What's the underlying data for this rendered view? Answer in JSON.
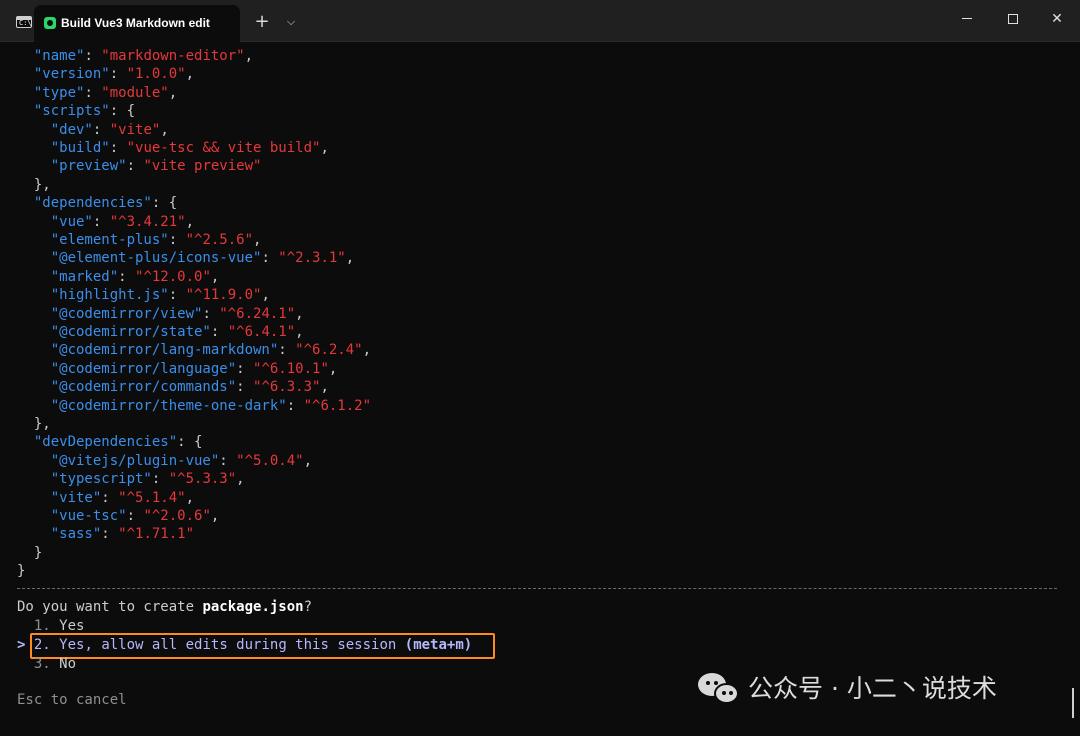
{
  "window": {
    "tab_title": "Build Vue3 Markdown edit",
    "new_tab": "+",
    "dropdown": "⌵",
    "minimize": "",
    "maximize": "",
    "close": "✕",
    "terminal_icon_label": "C:\\"
  },
  "json_lines": [
    [
      [
        "  ",
        "p"
      ],
      [
        "\"name\"",
        "k"
      ],
      [
        ": ",
        "p"
      ],
      [
        "\"markdown-editor\"",
        "s"
      ],
      [
        ",",
        "p"
      ]
    ],
    [
      [
        "  ",
        "p"
      ],
      [
        "\"version\"",
        "k"
      ],
      [
        ": ",
        "p"
      ],
      [
        "\"1.0.0\"",
        "s"
      ],
      [
        ",",
        "p"
      ]
    ],
    [
      [
        "  ",
        "p"
      ],
      [
        "\"type\"",
        "k"
      ],
      [
        ": ",
        "p"
      ],
      [
        "\"module\"",
        "s"
      ],
      [
        ",",
        "p"
      ]
    ],
    [
      [
        "  ",
        "p"
      ],
      [
        "\"scripts\"",
        "k"
      ],
      [
        ": {",
        "p"
      ]
    ],
    [
      [
        "    ",
        "p"
      ],
      [
        "\"dev\"",
        "k"
      ],
      [
        ": ",
        "p"
      ],
      [
        "\"vite\"",
        "s"
      ],
      [
        ",",
        "p"
      ]
    ],
    [
      [
        "    ",
        "p"
      ],
      [
        "\"build\"",
        "k"
      ],
      [
        ": ",
        "p"
      ],
      [
        "\"vue-tsc && vite build\"",
        "s"
      ],
      [
        ",",
        "p"
      ]
    ],
    [
      [
        "    ",
        "p"
      ],
      [
        "\"preview\"",
        "k"
      ],
      [
        ": ",
        "p"
      ],
      [
        "\"vite preview\"",
        "s"
      ]
    ],
    [
      [
        "  },",
        "p"
      ]
    ],
    [
      [
        "  ",
        "p"
      ],
      [
        "\"dependencies\"",
        "k"
      ],
      [
        ": {",
        "p"
      ]
    ],
    [
      [
        "    ",
        "p"
      ],
      [
        "\"vue\"",
        "k"
      ],
      [
        ": ",
        "p"
      ],
      [
        "\"^3.4.21\"",
        "s"
      ],
      [
        ",",
        "p"
      ]
    ],
    [
      [
        "    ",
        "p"
      ],
      [
        "\"element-plus\"",
        "k"
      ],
      [
        ": ",
        "p"
      ],
      [
        "\"^2.5.6\"",
        "s"
      ],
      [
        ",",
        "p"
      ]
    ],
    [
      [
        "    ",
        "p"
      ],
      [
        "\"@element-plus/icons-vue\"",
        "k"
      ],
      [
        ": ",
        "p"
      ],
      [
        "\"^2.3.1\"",
        "s"
      ],
      [
        ",",
        "p"
      ]
    ],
    [
      [
        "    ",
        "p"
      ],
      [
        "\"marked\"",
        "k"
      ],
      [
        ": ",
        "p"
      ],
      [
        "\"^12.0.0\"",
        "s"
      ],
      [
        ",",
        "p"
      ]
    ],
    [
      [
        "    ",
        "p"
      ],
      [
        "\"highlight.js\"",
        "k"
      ],
      [
        ": ",
        "p"
      ],
      [
        "\"^11.9.0\"",
        "s"
      ],
      [
        ",",
        "p"
      ]
    ],
    [
      [
        "    ",
        "p"
      ],
      [
        "\"@codemirror/view\"",
        "k"
      ],
      [
        ": ",
        "p"
      ],
      [
        "\"^6.24.1\"",
        "s"
      ],
      [
        ",",
        "p"
      ]
    ],
    [
      [
        "    ",
        "p"
      ],
      [
        "\"@codemirror/state\"",
        "k"
      ],
      [
        ": ",
        "p"
      ],
      [
        "\"^6.4.1\"",
        "s"
      ],
      [
        ",",
        "p"
      ]
    ],
    [
      [
        "    ",
        "p"
      ],
      [
        "\"@codemirror/lang-markdown\"",
        "k"
      ],
      [
        ": ",
        "p"
      ],
      [
        "\"^6.2.4\"",
        "s"
      ],
      [
        ",",
        "p"
      ]
    ],
    [
      [
        "    ",
        "p"
      ],
      [
        "\"@codemirror/language\"",
        "k"
      ],
      [
        ": ",
        "p"
      ],
      [
        "\"^6.10.1\"",
        "s"
      ],
      [
        ",",
        "p"
      ]
    ],
    [
      [
        "    ",
        "p"
      ],
      [
        "\"@codemirror/commands\"",
        "k"
      ],
      [
        ": ",
        "p"
      ],
      [
        "\"^6.3.3\"",
        "s"
      ],
      [
        ",",
        "p"
      ]
    ],
    [
      [
        "    ",
        "p"
      ],
      [
        "\"@codemirror/theme-one-dark\"",
        "k"
      ],
      [
        ": ",
        "p"
      ],
      [
        "\"^6.1.2\"",
        "s"
      ]
    ],
    [
      [
        "  },",
        "p"
      ]
    ],
    [
      [
        "  ",
        "p"
      ],
      [
        "\"devDependencies\"",
        "k"
      ],
      [
        ": {",
        "p"
      ]
    ],
    [
      [
        "    ",
        "p"
      ],
      [
        "\"@vitejs/plugin-vue\"",
        "k"
      ],
      [
        ": ",
        "p"
      ],
      [
        "\"^5.0.4\"",
        "s"
      ],
      [
        ",",
        "p"
      ]
    ],
    [
      [
        "    ",
        "p"
      ],
      [
        "\"typescript\"",
        "k"
      ],
      [
        ": ",
        "p"
      ],
      [
        "\"^5.3.3\"",
        "s"
      ],
      [
        ",",
        "p"
      ]
    ],
    [
      [
        "    ",
        "p"
      ],
      [
        "\"vite\"",
        "k"
      ],
      [
        ": ",
        "p"
      ],
      [
        "\"^5.1.4\"",
        "s"
      ],
      [
        ",",
        "p"
      ]
    ],
    [
      [
        "    ",
        "p"
      ],
      [
        "\"vue-tsc\"",
        "k"
      ],
      [
        ": ",
        "p"
      ],
      [
        "\"^2.0.6\"",
        "s"
      ],
      [
        ",",
        "p"
      ]
    ],
    [
      [
        "    ",
        "p"
      ],
      [
        "\"sass\"",
        "k"
      ],
      [
        ": ",
        "p"
      ],
      [
        "\"^1.71.1\"",
        "s"
      ]
    ],
    [
      [
        "  }",
        "p"
      ]
    ],
    [
      [
        "}",
        "p"
      ]
    ]
  ],
  "prompt": {
    "question_prefix": "Do you want to create ",
    "question_file": "package.json",
    "question_suffix": "?",
    "options": [
      {
        "caret": " ",
        "number": "1.",
        "label": "Yes",
        "shortcut": ""
      },
      {
        "caret": ">",
        "number": "2.",
        "label": "Yes, allow all edits during this session",
        "shortcut": "(meta+m)"
      },
      {
        "caret": " ",
        "number": "3.",
        "label": "No",
        "shortcut": ""
      }
    ],
    "cancel_hint": "Esc to cancel"
  },
  "watermark": {
    "text": "公众号 · 小二丶说技术"
  },
  "colors": {
    "key": "#3b8eea",
    "string": "#e5383b",
    "selected": "#b4b8ff",
    "highlight_border": "#ff8a1f"
  }
}
